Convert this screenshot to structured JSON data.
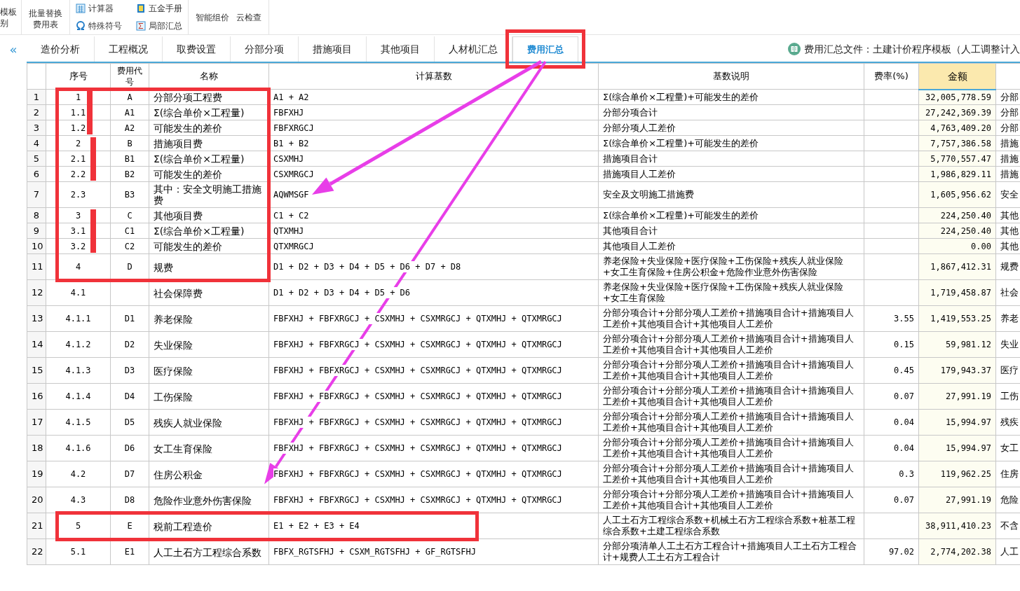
{
  "toolbar": {
    "cut_left": [
      "模板",
      "别"
    ],
    "big_button": [
      "批量替换",
      "费用表"
    ],
    "tools": [
      {
        "kind": "calculator",
        "label": "计算器"
      },
      {
        "kind": "omega",
        "label": "特殊符号"
      },
      {
        "kind": "book",
        "label": "五金手册"
      },
      {
        "kind": "sigma",
        "label": "局部汇总"
      }
    ],
    "links": [
      "智能组价",
      "云检查"
    ]
  },
  "collapse_icon": "«",
  "tabs": [
    {
      "label": "造价分析",
      "selected": false
    },
    {
      "label": "工程概况",
      "selected": false
    },
    {
      "label": "取费设置",
      "selected": false
    },
    {
      "label": "分部分项",
      "selected": false
    },
    {
      "label": "措施项目",
      "selected": false
    },
    {
      "label": "其他项目",
      "selected": false
    },
    {
      "label": "人材机汇总",
      "selected": false
    },
    {
      "label": "费用汇总",
      "selected": true
    }
  ],
  "file_info": "费用汇总文件：土建计价程序模板（人工调整计入",
  "table": {
    "columns": [
      "序号",
      "费用代号",
      "名称",
      "计算基数",
      "基数说明",
      "费率(%)",
      "金额"
    ],
    "rows": [
      {
        "n": "1",
        "seq": "1",
        "code": "A",
        "name": "分部分项工程费",
        "base": "A1 + A2",
        "desc": "Σ(综合单价×工程量)+可能发生的差价",
        "amount": "32,005,778.59",
        "column_8": "分部"
      },
      {
        "n": "2",
        "seq": "1.1",
        "code": "A1",
        "name": "Σ(综合单价×工程量)",
        "base": "FBFXHJ",
        "desc": "分部分项合计",
        "amount": "27,242,369.39",
        "column_8": "分部"
      },
      {
        "n": "3",
        "seq": "1.2",
        "code": "A2",
        "name": "可能发生的差价",
        "base": "FBFXRGCJ",
        "desc": "分部分项人工差价",
        "amount": "4,763,409.20",
        "column_8": "分部"
      },
      {
        "n": "4",
        "seq": "2",
        "code": "B",
        "name": "措施项目费",
        "base": "B1 + B2",
        "desc": "Σ(综合单价×工程量)+可能发生的差价",
        "amount": "7,757,386.58",
        "column_8": "措施"
      },
      {
        "n": "5",
        "seq": "2.1",
        "code": "B1",
        "name": "Σ(综合单价×工程量)",
        "base": "CSXMHJ",
        "desc": "措施项目合计",
        "amount": "5,770,557.47",
        "column_8": "措施"
      },
      {
        "n": "6",
        "seq": "2.2",
        "code": "B2",
        "name": "可能发生的差价",
        "base": "CSXMRGCJ",
        "desc": "措施项目人工差价",
        "amount": "1,986,829.11",
        "column_8": "措施"
      },
      {
        "n": "7",
        "seq": "2.3",
        "code": "B3",
        "name": "其中：安全文明施工措施费",
        "base": "AQWMSGF",
        "desc": "安全及文明施工措施费",
        "amount": "1,605,956.62",
        "column_8": "安全"
      },
      {
        "n": "8",
        "seq": "3",
        "code": "C",
        "name": "其他项目费",
        "base": "C1 + C2",
        "desc": "Σ(综合单价×工程量)+可能发生的差价",
        "amount": "224,250.40",
        "column_8": "其他"
      },
      {
        "n": "9",
        "seq": "3.1",
        "code": "C1",
        "name": "Σ(综合单价×工程量)",
        "base": "QTXMHJ",
        "desc": "其他项目合计",
        "amount": "224,250.40",
        "column_8": "其他"
      },
      {
        "n": "10",
        "seq": "3.2",
        "code": "C2",
        "name": "可能发生的差价",
        "base": "QTXMRGCJ",
        "desc": "其他项目人工差价",
        "amount": "0.00",
        "column_8": "其他"
      },
      {
        "n": "11",
        "seq": "4",
        "code": "D",
        "name": "规费",
        "base": "D1 + D2 + D3 + D4 + D5 + D6 + D7 + D8",
        "desc": "养老保险+失业保险+医疗保险+工伤保险+残疾人就业保险+女工生育保险+住房公积金+危险作业意外伤害保险",
        "amount": "1,867,412.31",
        "column_8": "规费"
      },
      {
        "n": "12",
        "seq": "4.1",
        "name": "社会保障费",
        "base": "D1 + D2 + D3 + D4 + D5 + D6",
        "desc": "养老保险+失业保险+医疗保险+工伤保险+残疾人就业保险+女工生育保险",
        "amount": "1,719,458.87",
        "column_8": "社会"
      },
      {
        "n": "13",
        "seq": "4.1.1",
        "code": "D1",
        "name": "养老保险",
        "base": "FBFXHJ + FBFXRGCJ + CSXMHJ + CSXMRGCJ + QTXMHJ + QTXMRGCJ",
        "desc": "分部分项合计+分部分项人工差价+措施项目合计+措施项目人工差价+其他项目合计+其他项目人工差价",
        "rate": "3.55",
        "amount": "1,419,553.25",
        "column_8": "养老"
      },
      {
        "n": "14",
        "seq": "4.1.2",
        "code": "D2",
        "name": "失业保险",
        "base": "FBFXHJ + FBFXRGCJ + CSXMHJ + CSXMRGCJ + QTXMHJ + QTXMRGCJ",
        "desc": "分部分项合计+分部分项人工差价+措施项目合计+措施项目人工差价+其他项目合计+其他项目人工差价",
        "rate": "0.15",
        "amount": "59,981.12",
        "column_8": "失业"
      },
      {
        "n": "15",
        "seq": "4.1.3",
        "code": "D3",
        "name": "医疗保险",
        "base": "FBFXHJ + FBFXRGCJ + CSXMHJ + CSXMRGCJ + QTXMHJ + QTXMRGCJ",
        "desc": "分部分项合计+分部分项人工差价+措施项目合计+措施项目人工差价+其他项目合计+其他项目人工差价",
        "rate": "0.45",
        "amount": "179,943.37",
        "column_8": "医疗"
      },
      {
        "n": "16",
        "seq": "4.1.4",
        "code": "D4",
        "name": "工伤保险",
        "base": "FBFXHJ + FBFXRGCJ + CSXMHJ + CSXMRGCJ + QTXMHJ + QTXMRGCJ",
        "desc": "分部分项合计+分部分项人工差价+措施项目合计+措施项目人工差价+其他项目合计+其他项目人工差价",
        "rate": "0.07",
        "amount": "27,991.19",
        "column_8": "工伤"
      },
      {
        "n": "17",
        "seq": "4.1.5",
        "code": "D5",
        "name": "残疾人就业保险",
        "base": "FBFXHJ + FBFXRGCJ + CSXMHJ + CSXMRGCJ + QTXMHJ + QTXMRGCJ",
        "desc": "分部分项合计+分部分项人工差价+措施项目合计+措施项目人工差价+其他项目合计+其他项目人工差价",
        "rate": "0.04",
        "amount": "15,994.97",
        "column_8": "残疾"
      },
      {
        "n": "18",
        "seq": "4.1.6",
        "code": "D6",
        "name": "女工生育保险",
        "base": "FBFXHJ + FBFXRGCJ + CSXMHJ + CSXMRGCJ + QTXMHJ + QTXMRGCJ",
        "desc": "分部分项合计+分部分项人工差价+措施项目合计+措施项目人工差价+其他项目合计+其他项目人工差价",
        "rate": "0.04",
        "amount": "15,994.97",
        "column_8": "女工"
      },
      {
        "n": "19",
        "seq": "4.2",
        "code": "D7",
        "name": "住房公积金",
        "base": "FBFXHJ + FBFXRGCJ + CSXMHJ + CSXMRGCJ + QTXMHJ + QTXMRGCJ",
        "desc": "分部分项合计+分部分项人工差价+措施项目合计+措施项目人工差价+其他项目合计+其他项目人工差价",
        "rate": "0.3",
        "amount": "119,962.25",
        "column_8": "住房"
      },
      {
        "n": "20",
        "seq": "4.3",
        "code": "D8",
        "name": "危险作业意外伤害保险",
        "base": "FBFXHJ + FBFXRGCJ + CSXMHJ + CSXMRGCJ + QTXMHJ + QTXMRGCJ",
        "desc": "分部分项合计+分部分项人工差价+措施项目合计+措施项目人工差价+其他项目合计+其他项目人工差价",
        "rate": "0.07",
        "amount": "27,991.19",
        "column_8": "危险"
      },
      {
        "n": "21",
        "seq": "5",
        "code": "E",
        "name": "税前工程造价",
        "base": "E1 + E2 + E3 + E4",
        "desc": "人工土石方工程综合系数+机械土石方工程综合系数+桩基工程综合系数+土建工程综合系数",
        "amount": "38,911,410.23",
        "column_8": "不含"
      },
      {
        "n": "22",
        "seq": "5.1",
        "code": "E1",
        "name": "人工土石方工程综合系数",
        "base": "FBFX_RGTSFHJ + CSXM_RGTSFHJ + GF_RGTSFHJ",
        "desc": "分部分项清单人工土石方工程合计+措施项目人工土石方工程合计+规费人工土石方工程合计",
        "rate": "97.02",
        "amount": "2,774,202.38",
        "column_8": "人工"
      }
    ]
  }
}
